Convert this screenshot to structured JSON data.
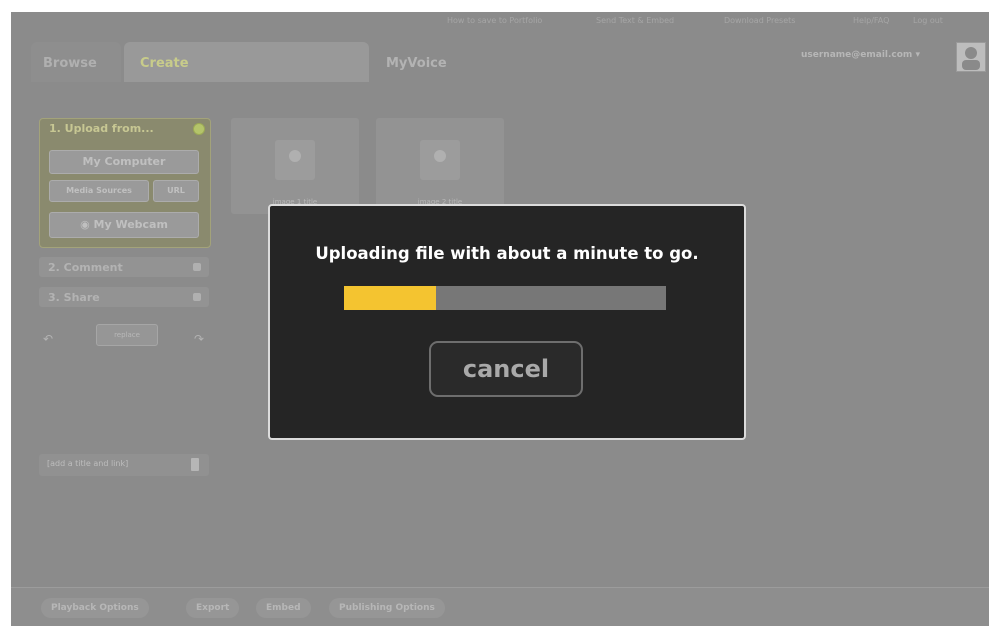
{
  "top_links": [
    "How to save to Portfolio",
    "Send Text & Embed",
    "Download Presets",
    "Help/FAQ",
    "Log out"
  ],
  "tabs": [
    {
      "label": "Browse"
    },
    {
      "label": "Create"
    },
    {
      "label": "MyVoice"
    }
  ],
  "account": {
    "email": "username@email.com ▾"
  },
  "upload_panel": {
    "title": "1. Upload from...",
    "my_computer": "My Computer",
    "media_sources": "Media Sources",
    "url": "URL",
    "my_webcam": "My Webcam"
  },
  "steps": [
    {
      "label": "2. Comment"
    },
    {
      "label": "3. Share"
    }
  ],
  "replace_label": "replace",
  "title_field": "[add a title and link]",
  "thumbnails": [
    {
      "label": "image 1 title"
    },
    {
      "label": "image 2 title"
    }
  ],
  "bottom_bar": [
    "Playback Options",
    "Export",
    "Embed",
    "Publishing Options"
  ],
  "modal": {
    "message": "Uploading file with about a minute to go.",
    "cancel_label": "cancel",
    "progress": 0.285
  },
  "colors": {
    "progress_fill": "#f4c430",
    "modal_bg": "#252525",
    "overlay_bg": "#8b8b8b"
  }
}
